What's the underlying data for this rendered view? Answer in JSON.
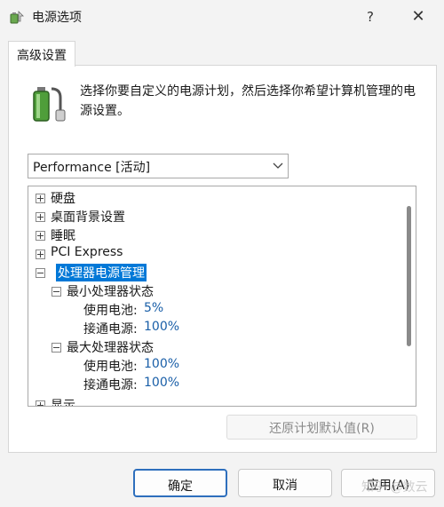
{
  "window": {
    "title": "电源选项",
    "help_label": "?",
    "close_label": "✕"
  },
  "tab": {
    "label": "高级设置"
  },
  "description": "选择你要自定义的电源计划，然后选择你希望计算机管理的电源设置。",
  "plan_select": {
    "value": "Performance [活动]"
  },
  "tree": {
    "items": [
      {
        "label": "硬盘"
      },
      {
        "label": "桌面背景设置"
      },
      {
        "label": "睡眠"
      },
      {
        "label": "PCI Express"
      },
      {
        "label": "处理器电源管理"
      },
      {
        "label": "最小处理器状态"
      },
      {
        "label": "使用电池:",
        "value": "5%"
      },
      {
        "label": "接通电源:",
        "value": "100%"
      },
      {
        "label": "最大处理器状态"
      },
      {
        "label": "使用电池:",
        "value": "100%"
      },
      {
        "label": "接通电源:",
        "value": "100%"
      },
      {
        "label": "显示"
      }
    ]
  },
  "restore_button": {
    "label": "还原计划默认值(R)"
  },
  "buttons": {
    "ok": "确定",
    "cancel": "取消",
    "apply": "应用(A)"
  },
  "watermark": "知乎 @数云"
}
